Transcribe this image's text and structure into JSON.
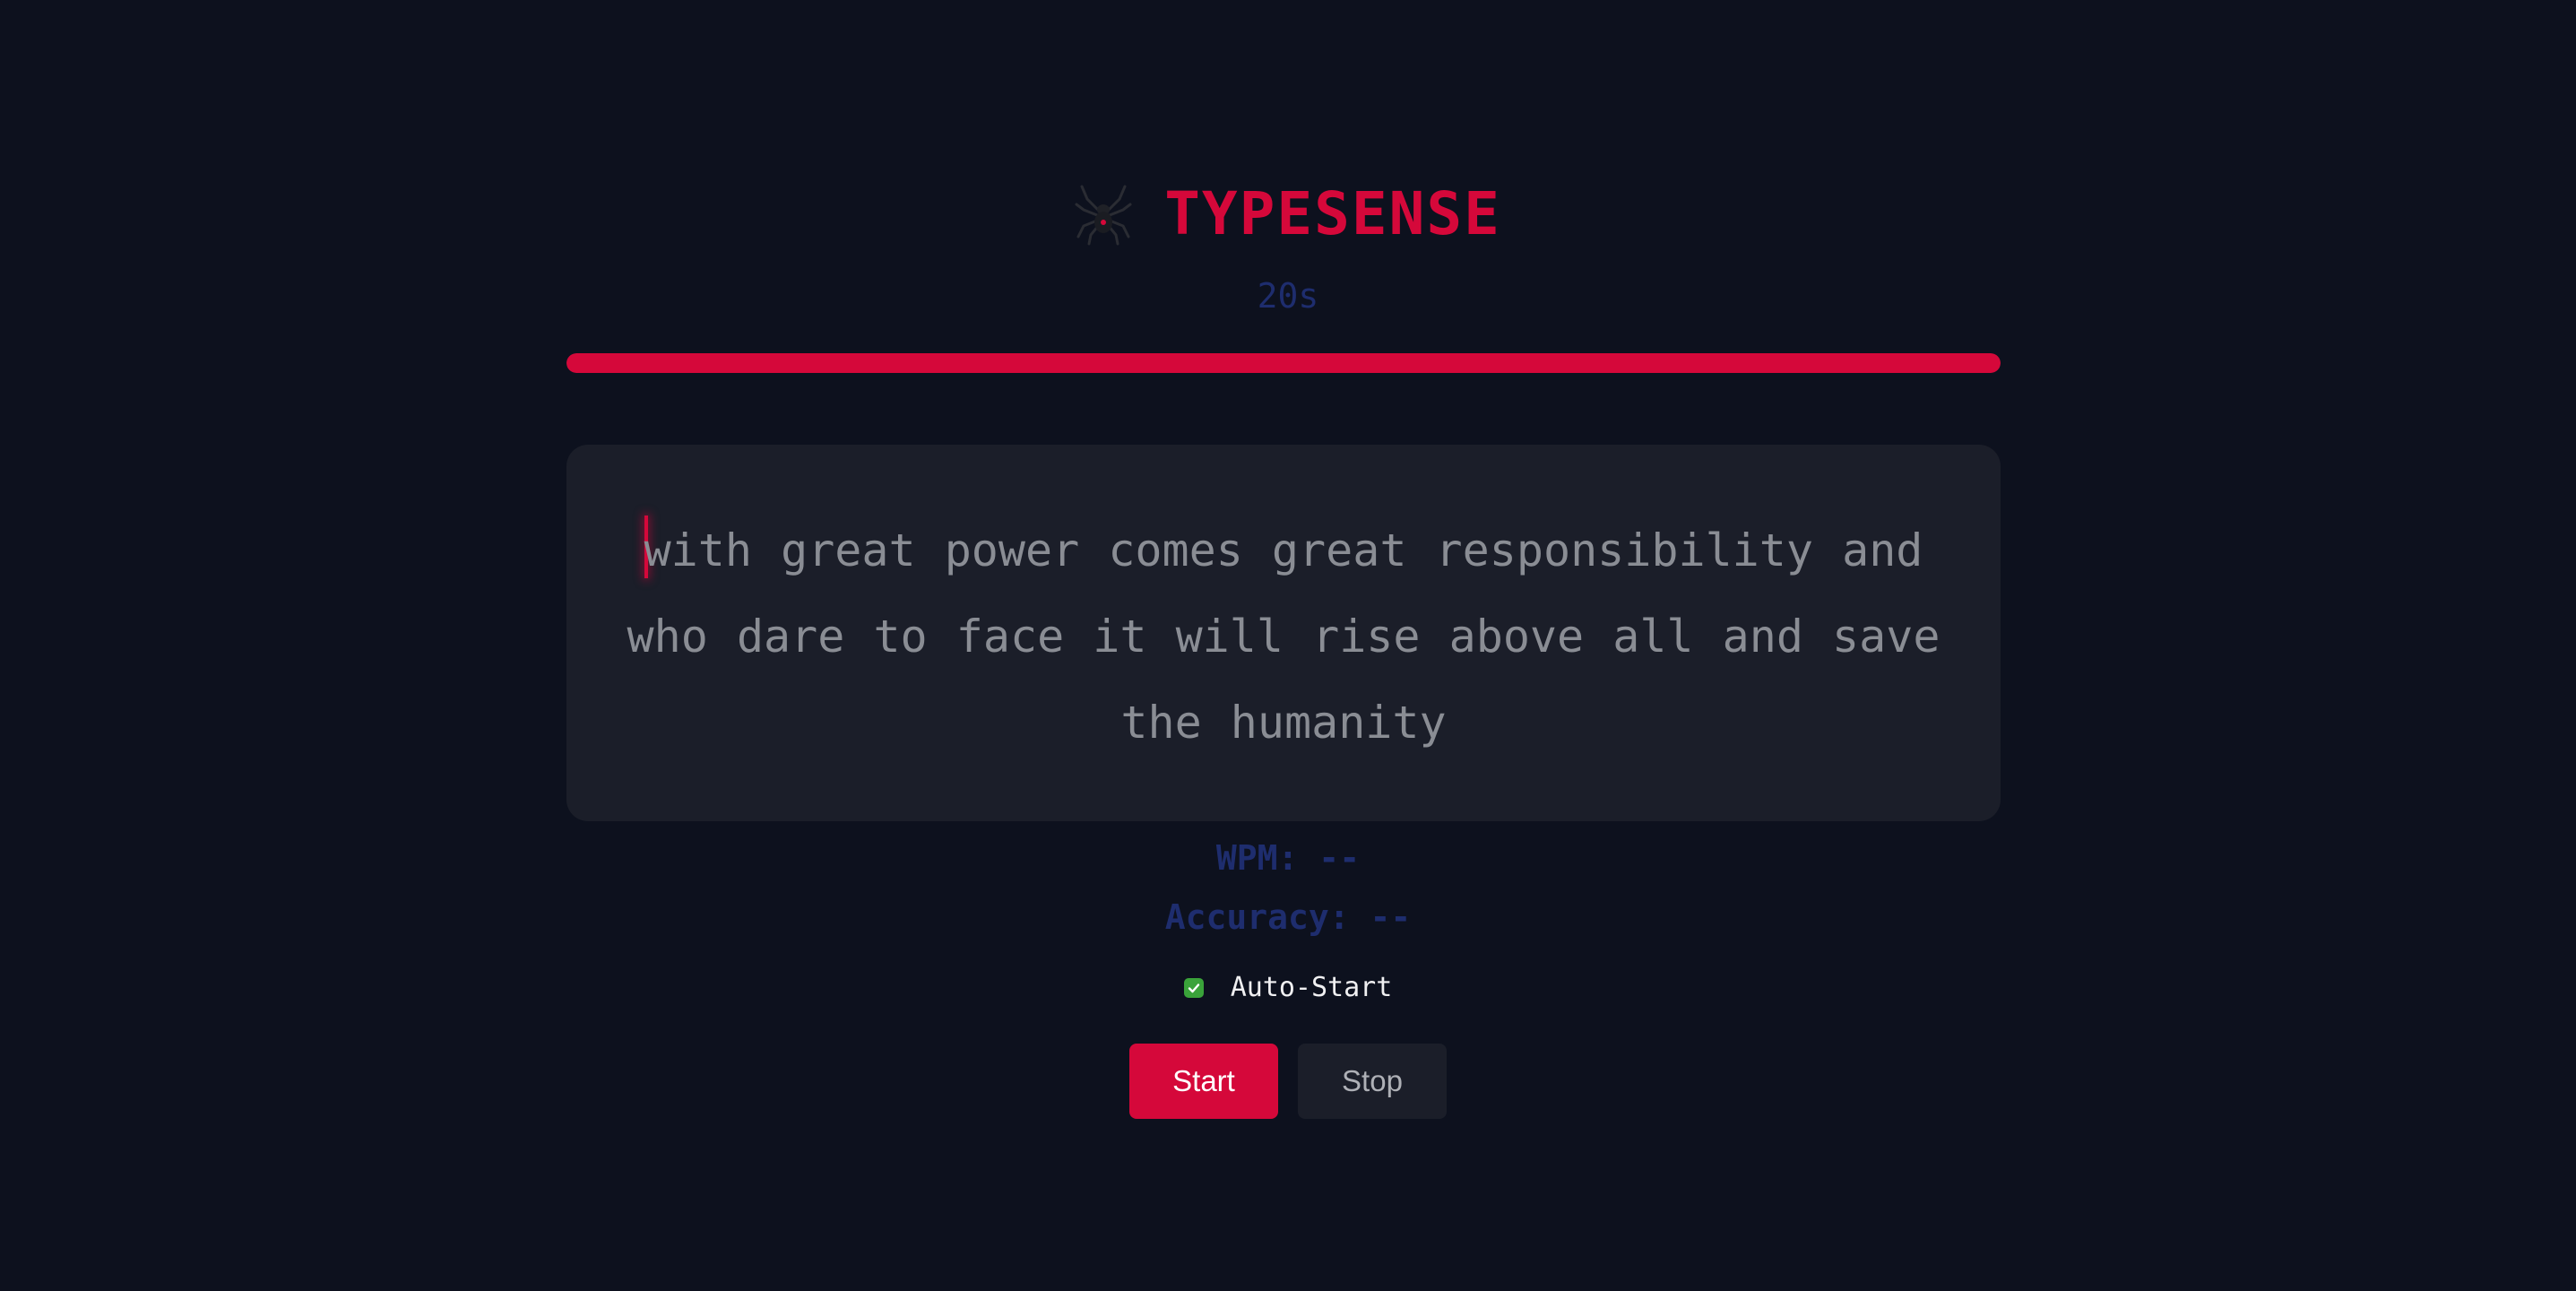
{
  "app": {
    "title": "TYPESENSE",
    "logo_icon": "spider-icon"
  },
  "timer": {
    "label": "20s",
    "progress_fraction": 1.0
  },
  "passage": {
    "text": "with great power comes great responsibility and who dare to face it will rise above all and save the humanity",
    "caret_position": 0
  },
  "stats": {
    "wpm": "WPM: --",
    "accuracy": "Accuracy: --"
  },
  "auto_start": {
    "label": "Auto-Start",
    "checked": true
  },
  "controls": {
    "start_label": "Start",
    "stop_label": "Stop"
  },
  "colors": {
    "accent": "#d5083a",
    "background": "#0d111e",
    "panel": "#1b1e29",
    "stat_text": "#1e2d6e",
    "checkbox": "#3aa33a"
  }
}
